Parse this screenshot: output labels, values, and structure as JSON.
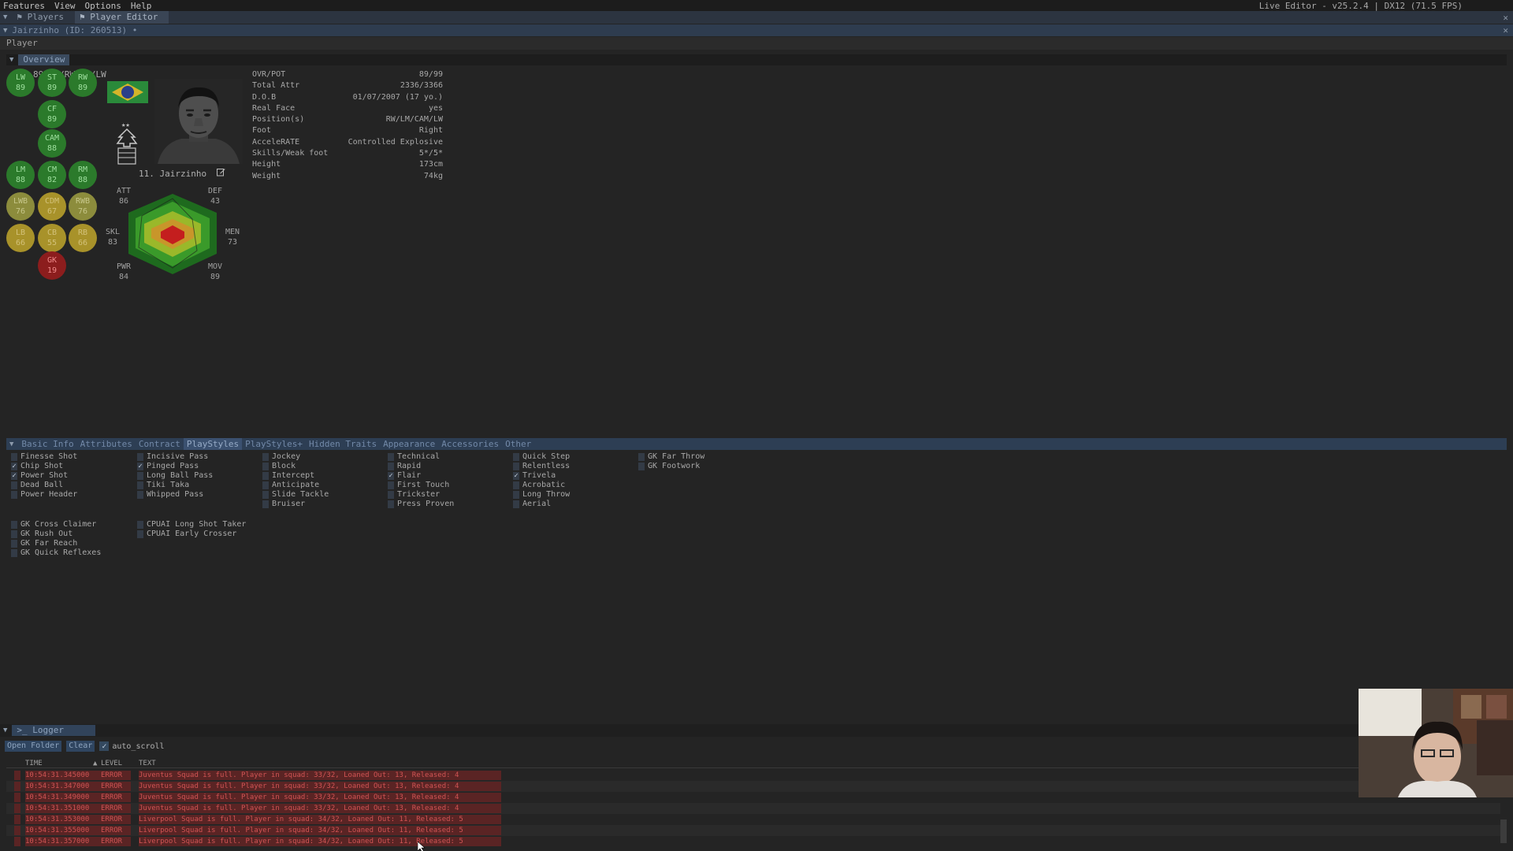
{
  "menu": {
    "items": [
      "Features",
      "View",
      "Options",
      "Help"
    ],
    "fps_overlay": "71 FPS",
    "status": "Live Editor - v25.2.4 | DX12 (71.5 FPS)"
  },
  "tabs": [
    {
      "label": "Players"
    },
    {
      "label": "Player Editor"
    }
  ],
  "doc_title": "Jairzinho (ID: 260513) •",
  "panel_title": "Player",
  "overview_tab": "Overview",
  "positions_line": "89 CF/RW/ST/LW",
  "positions": [
    {
      "pos": "LW",
      "rating": "89",
      "tier": "green"
    },
    {
      "pos": "ST",
      "rating": "89",
      "tier": "green"
    },
    {
      "pos": "RW",
      "rating": "89",
      "tier": "green"
    },
    {
      "pos": "CF",
      "rating": "89",
      "tier": "green"
    },
    {
      "pos": "CAM",
      "rating": "88",
      "tier": "green"
    },
    {
      "pos": "LM",
      "rating": "88",
      "tier": "green"
    },
    {
      "pos": "CM",
      "rating": "82",
      "tier": "green"
    },
    {
      "pos": "RM",
      "rating": "88",
      "tier": "green"
    },
    {
      "pos": "LWB",
      "rating": "76",
      "tier": "olive"
    },
    {
      "pos": "CDM",
      "rating": "67",
      "tier": "yellow"
    },
    {
      "pos": "RWB",
      "rating": "76",
      "tier": "olive"
    },
    {
      "pos": "LB",
      "rating": "66",
      "tier": "yellow"
    },
    {
      "pos": "CB",
      "rating": "55",
      "tier": "yellow"
    },
    {
      "pos": "RB",
      "rating": "66",
      "tier": "yellow"
    },
    {
      "pos": "GK",
      "rating": "19",
      "tier": "red"
    }
  ],
  "player_name": "11. Jairzinho",
  "radar": {
    "att": {
      "label": "ATT",
      "value": "86"
    },
    "def": {
      "label": "DEF",
      "value": "43"
    },
    "skl": {
      "label": "SKL",
      "value": "83"
    },
    "men": {
      "label": "MEN",
      "value": "73"
    },
    "pwr": {
      "label": "PWR",
      "value": "84"
    },
    "mov": {
      "label": "MOV",
      "value": "89"
    }
  },
  "info": [
    {
      "label": "OVR/POT",
      "value": "89/99"
    },
    {
      "label": "Total Attr",
      "value": "2336/3366"
    },
    {
      "label": "D.O.B",
      "value": "01/07/2007 (17 yo.)"
    },
    {
      "label": "Real Face",
      "value": "yes"
    },
    {
      "label": "Position(s)",
      "value": "RW/LM/CAM/LW"
    },
    {
      "label": "Foot",
      "value": "Right"
    },
    {
      "label": "AcceleRATE",
      "value": "Controlled Explosive"
    },
    {
      "label": "Skills/Weak foot",
      "value": "5*/5*"
    },
    {
      "label": "Height",
      "value": "173cm"
    },
    {
      "label": "Weight",
      "value": "74kg"
    }
  ],
  "detail_tabs": [
    "Basic Info",
    "Attributes",
    "Contract",
    "PlayStyles",
    "PlayStyles+",
    "Hidden Traits",
    "Appearance",
    "Accessories",
    "Other"
  ],
  "detail_tab_active": "PlayStyles",
  "playstyles": [
    [
      {
        "label": "Finesse Shot",
        "checked": false
      },
      {
        "label": "Chip Shot",
        "checked": true
      },
      {
        "label": "Power Shot",
        "checked": true
      },
      {
        "label": "Dead Ball",
        "checked": false
      },
      {
        "label": "Power Header",
        "checked": false
      }
    ],
    [
      {
        "label": "Incisive Pass",
        "checked": false
      },
      {
        "label": "Pinged Pass",
        "checked": true
      },
      {
        "label": "Long Ball Pass",
        "checked": false
      },
      {
        "label": "Tiki Taka",
        "checked": false
      },
      {
        "label": "Whipped Pass",
        "checked": false
      }
    ],
    [
      {
        "label": "Jockey",
        "checked": false
      },
      {
        "label": "Block",
        "checked": false
      },
      {
        "label": "Intercept",
        "checked": false
      },
      {
        "label": "Anticipate",
        "checked": false
      },
      {
        "label": "Slide Tackle",
        "checked": false
      },
      {
        "label": "Bruiser",
        "checked": false
      }
    ],
    [
      {
        "label": "Technical",
        "checked": false
      },
      {
        "label": "Rapid",
        "checked": false
      },
      {
        "label": "Flair",
        "checked": true
      },
      {
        "label": "First Touch",
        "checked": false
      },
      {
        "label": "Trickster",
        "checked": false
      },
      {
        "label": "Press Proven",
        "checked": false
      }
    ],
    [
      {
        "label": "Quick Step",
        "checked": false
      },
      {
        "label": "Relentless",
        "checked": false
      },
      {
        "label": "Trivela",
        "checked": true
      },
      {
        "label": "Acrobatic",
        "checked": false
      },
      {
        "label": "Long Throw",
        "checked": false
      },
      {
        "label": "Aerial",
        "checked": false
      }
    ],
    [
      {
        "label": "GK Far Throw",
        "checked": false
      },
      {
        "label": "GK Footwork",
        "checked": false
      }
    ]
  ],
  "playstyles_gk": [
    [
      {
        "label": "GK Cross Claimer",
        "checked": false
      },
      {
        "label": "GK Rush Out",
        "checked": false
      },
      {
        "label": "GK Far Reach",
        "checked": false
      },
      {
        "label": "GK Quick Reflexes",
        "checked": false
      }
    ],
    [
      {
        "label": "CPUAI Long Shot Taker",
        "checked": false
      },
      {
        "label": "CPUAI Early Crosser",
        "checked": false
      }
    ]
  ],
  "logger": {
    "tab": "Logger",
    "open_folder": "Open Folder",
    "clear": "Clear",
    "auto_scroll": "auto_scroll",
    "cols": {
      "time": "TIME",
      "level": "LEVEL",
      "text": "TEXT"
    },
    "rows": [
      {
        "time": "10:54:31.345000",
        "level": "ERROR",
        "text": "Juventus Squad is full. Player in squad: 33/32, Loaned Out: 13, Released: 4"
      },
      {
        "time": "10:54:31.347000",
        "level": "ERROR",
        "text": "Juventus Squad is full. Player in squad: 33/32, Loaned Out: 13, Released: 4"
      },
      {
        "time": "10:54:31.349000",
        "level": "ERROR",
        "text": "Juventus Squad is full. Player in squad: 33/32, Loaned Out: 13, Released: 4"
      },
      {
        "time": "10:54:31.351000",
        "level": "ERROR",
        "text": "Juventus Squad is full. Player in squad: 33/32, Loaned Out: 13, Released: 4"
      },
      {
        "time": "10:54:31.353000",
        "level": "ERROR",
        "text": "Liverpool Squad is full. Player in squad: 34/32, Loaned Out: 11, Released: 5"
      },
      {
        "time": "10:54:31.355000",
        "level": "ERROR",
        "text": "Liverpool Squad is full. Player in squad: 34/32, Loaned Out: 11, Released: 5"
      },
      {
        "time": "10:54:31.357000",
        "level": "ERROR",
        "text": "Liverpool Squad is full. Player in squad: 34/32, Loaned Out: 11, Released: 5"
      }
    ]
  },
  "colors": {
    "green": "#2b7a2b",
    "olive": "#8c8c3c",
    "yellow": "#a8922a",
    "red": "#8c1d1d",
    "tab_accent": "#2d3e54"
  }
}
